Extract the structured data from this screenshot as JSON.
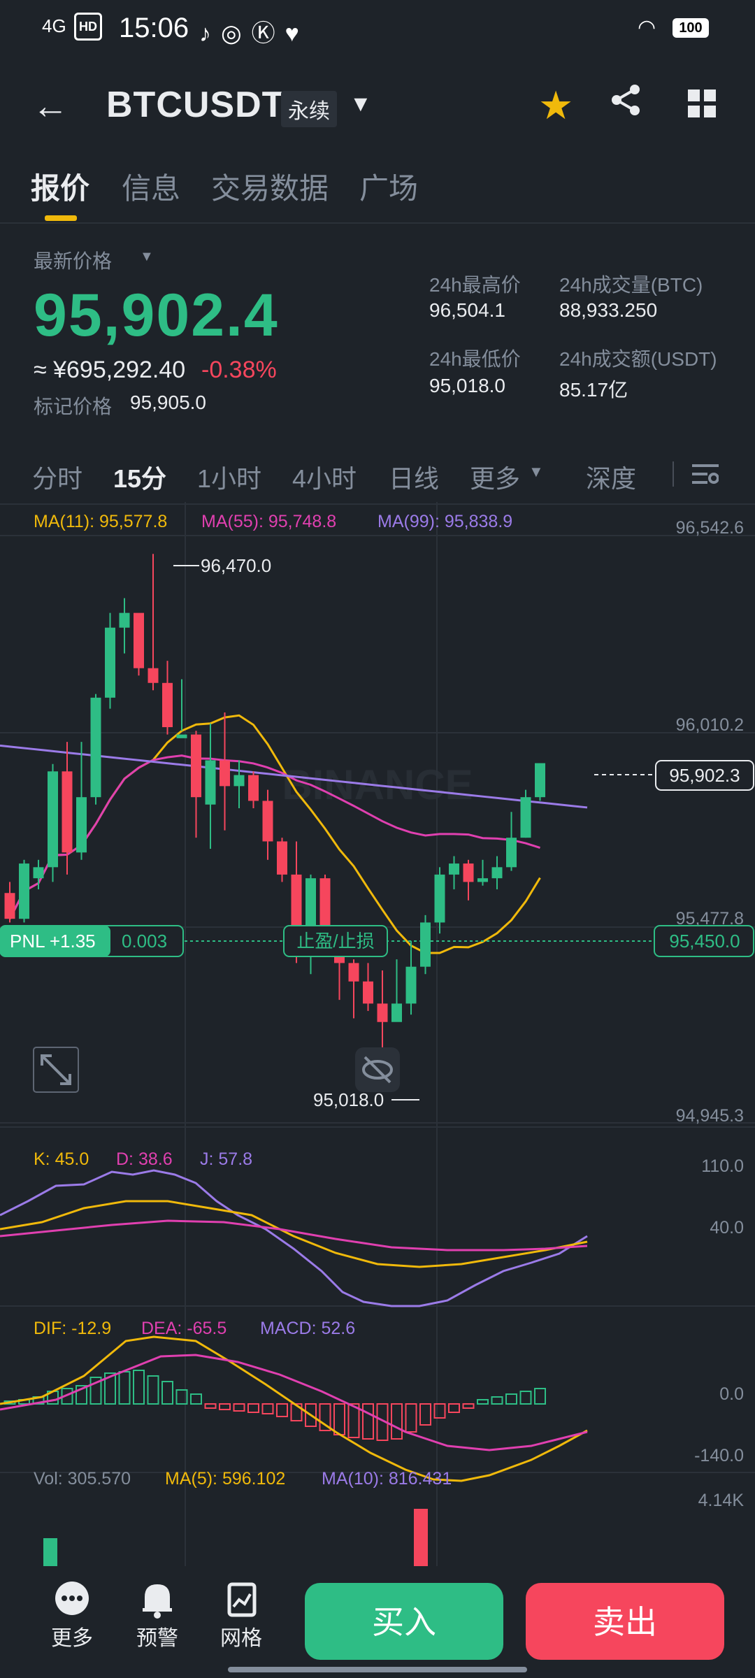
{
  "status_bar": {
    "signal": "4G",
    "hd": "HD",
    "time": "15:06",
    "battery": "100"
  },
  "header": {
    "back_icon": "arrow-left-icon",
    "symbol": "BTCUSDT",
    "contract_type": "永续"
  },
  "tabs": [
    {
      "label": "报价",
      "active": true
    },
    {
      "label": "信息",
      "active": false
    },
    {
      "label": "交易数据",
      "active": false
    },
    {
      "label": "广场",
      "active": false
    }
  ],
  "price": {
    "latest_label": "最新价格",
    "last": "95,902.4",
    "cny": "≈ ¥695,292.40",
    "change_pct": "-0.38%",
    "mark_label": "标记价格",
    "mark_price": "95,905.0"
  },
  "stats": {
    "high_label": "24h最高价",
    "high": "96,504.1",
    "low_label": "24h最低价",
    "low": "95,018.0",
    "vol_btc_label": "24h成交量(BTC)",
    "vol_btc": "88,933.250",
    "vol_usdt_label": "24h成交额(USDT)",
    "vol_usdt": "85.17亿"
  },
  "intervals": [
    {
      "label": "分时",
      "active": false
    },
    {
      "label": "15分",
      "active": true
    },
    {
      "label": "1小时",
      "active": false
    },
    {
      "label": "4小时",
      "active": false
    },
    {
      "label": "日线",
      "active": false
    },
    {
      "label": "更多",
      "active": false
    },
    {
      "label": "深度",
      "active": false
    }
  ],
  "chart_data": {
    "type": "candlestick",
    "ma_legend": {
      "ma11": "MA(11): 95,577.8",
      "ma55": "MA(55): 95,748.8",
      "ma99": "MA(99): 95,838.9"
    },
    "y_ticks": [
      "96,542.6",
      "96,010.2",
      "95,477.8",
      "94,945.3"
    ],
    "ylim": [
      94945.3,
      96542.6
    ],
    "high_label": "96,470.0",
    "low_label": "95,018.0",
    "current_price_label": "95,902.3",
    "position": {
      "pnl": "PNL +1.35",
      "size": "0.003",
      "tpsl": "止盈/止损",
      "entry_price": "95,450.0",
      "entry_value": 95450.0
    },
    "watermark": "BINANCE",
    "candles": [
      {
        "o": 95550,
        "h": 95580,
        "l": 95470,
        "c": 95480
      },
      {
        "o": 95480,
        "h": 95640,
        "l": 95470,
        "c": 95630
      },
      {
        "o": 95590,
        "h": 95640,
        "l": 95560,
        "c": 95620
      },
      {
        "o": 95620,
        "h": 95900,
        "l": 95580,
        "c": 95880
      },
      {
        "o": 95880,
        "h": 95960,
        "l": 95600,
        "c": 95660
      },
      {
        "o": 95660,
        "h": 95960,
        "l": 95640,
        "c": 95810
      },
      {
        "o": 95810,
        "h": 96090,
        "l": 95790,
        "c": 96080
      },
      {
        "o": 96080,
        "h": 96310,
        "l": 96050,
        "c": 96270
      },
      {
        "o": 96270,
        "h": 96350,
        "l": 96200,
        "c": 96310
      },
      {
        "o": 96310,
        "h": 96300,
        "l": 96140,
        "c": 96160
      },
      {
        "o": 96160,
        "h": 96470,
        "l": 96100,
        "c": 96120
      },
      {
        "o": 96120,
        "h": 96180,
        "l": 95980,
        "c": 96000
      },
      {
        "o": 95970,
        "h": 96130,
        "l": 95990,
        "c": 95980
      },
      {
        "o": 95980,
        "h": 95990,
        "l": 95700,
        "c": 95810
      },
      {
        "o": 95790,
        "h": 96010,
        "l": 95670,
        "c": 95910
      },
      {
        "o": 95910,
        "h": 96040,
        "l": 95720,
        "c": 95840
      },
      {
        "o": 95840,
        "h": 95910,
        "l": 95780,
        "c": 95870
      },
      {
        "o": 95870,
        "h": 95880,
        "l": 95780,
        "c": 95800
      },
      {
        "o": 95800,
        "h": 95830,
        "l": 95640,
        "c": 95690
      },
      {
        "o": 95690,
        "h": 95700,
        "l": 95580,
        "c": 95600
      },
      {
        "o": 95600,
        "h": 95690,
        "l": 95360,
        "c": 95450
      },
      {
        "o": 95450,
        "h": 95600,
        "l": 95330,
        "c": 95590
      },
      {
        "o": 95590,
        "h": 95600,
        "l": 95380,
        "c": 95430
      },
      {
        "o": 95430,
        "h": 95440,
        "l": 95260,
        "c": 95360
      },
      {
        "o": 95360,
        "h": 95370,
        "l": 95210,
        "c": 95310
      },
      {
        "o": 95310,
        "h": 95360,
        "l": 95230,
        "c": 95250
      },
      {
        "o": 95250,
        "h": 95340,
        "l": 95018,
        "c": 95200
      },
      {
        "o": 95200,
        "h": 95370,
        "l": 95210,
        "c": 95250
      },
      {
        "o": 95250,
        "h": 95420,
        "l": 95220,
        "c": 95350
      },
      {
        "o": 95350,
        "h": 95490,
        "l": 95330,
        "c": 95470
      },
      {
        "o": 95470,
        "h": 95620,
        "l": 95440,
        "c": 95600
      },
      {
        "o": 95600,
        "h": 95650,
        "l": 95560,
        "c": 95630
      },
      {
        "o": 95630,
        "h": 95640,
        "l": 95530,
        "c": 95580
      },
      {
        "o": 95580,
        "h": 95640,
        "l": 95570,
        "c": 95590
      },
      {
        "o": 95590,
        "h": 95650,
        "l": 95560,
        "c": 95620
      },
      {
        "o": 95620,
        "h": 95770,
        "l": 95610,
        "c": 95700
      },
      {
        "o": 95700,
        "h": 95830,
        "l": 95700,
        "c": 95810
      },
      {
        "o": 95810,
        "h": 95902.3,
        "l": 95800,
        "c": 95902.3
      }
    ],
    "kdj": {
      "legend_k": "K: 45.0",
      "legend_d": "D: 38.6",
      "legend_j": "J: 57.8",
      "y_ticks": [
        "110.0",
        "40.0"
      ]
    },
    "macd": {
      "legend_dif": "DIF: -12.9",
      "legend_dea": "DEA: -65.5",
      "legend_macd": "MACD: 52.6",
      "y_ticks": [
        "0.0",
        "-140.0"
      ]
    },
    "volume": {
      "legend_vol": "Vol: 305.570",
      "legend_ma5": "MA(5): 596.102",
      "legend_ma10": "MA(10): 816.431",
      "y_tick": "4.14K"
    }
  },
  "bottom_nav": [
    {
      "label": "更多",
      "icon": "more-dots-icon"
    },
    {
      "label": "预警",
      "icon": "bell-icon"
    },
    {
      "label": "网格",
      "icon": "grid-strategy-icon"
    }
  ],
  "actions": {
    "buy": "买入",
    "sell": "卖出"
  },
  "colors": {
    "up": "#2ebd85",
    "down": "#f6465d",
    "ma11": "#f0b90b",
    "ma55": "#e040b0",
    "ma99": "#9b7be8",
    "accent": "#f0b90b"
  }
}
